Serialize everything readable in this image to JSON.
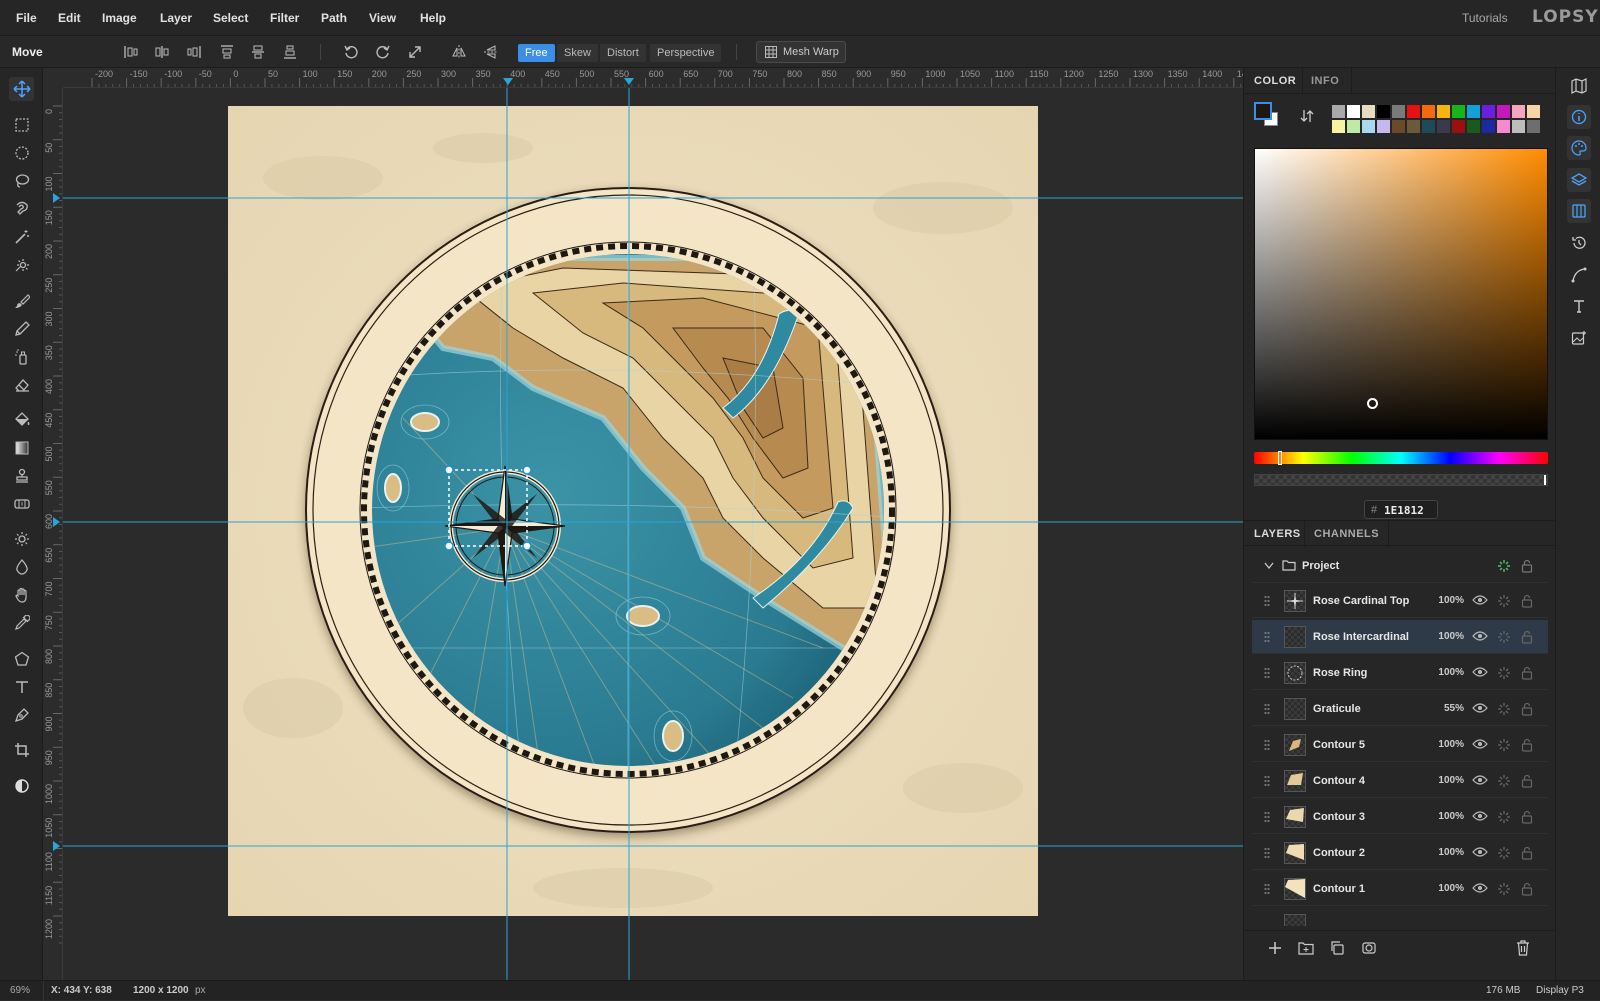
{
  "menu": {
    "items": [
      "File",
      "Edit",
      "Image",
      "Layer",
      "Select",
      "Filter",
      "Path",
      "View",
      "Help"
    ],
    "tutorials": "Tutorials",
    "logo": "LOPSY"
  },
  "options": {
    "tool_name": "Move",
    "modes": [
      "Free",
      "Skew",
      "Distort",
      "Perspective"
    ],
    "active_mode": "Free",
    "mesh_warp": "Mesh Warp"
  },
  "ruler": {
    "top": [
      "-200",
      "-150",
      "-100",
      "-50",
      "0",
      "50",
      "100",
      "150",
      "200",
      "250",
      "300",
      "350",
      "400",
      "450",
      "500",
      "550",
      "600",
      "650",
      "700",
      "750",
      "800",
      "850",
      "900",
      "950",
      "1000",
      "1050",
      "1100",
      "1150",
      "1200",
      "1250",
      "1300",
      "1350",
      "1400",
      "14"
    ],
    "left": [
      "0",
      "50",
      "100",
      "150",
      "200",
      "250",
      "300",
      "350",
      "400",
      "450",
      "500",
      "550",
      "600",
      "650",
      "700",
      "750",
      "800",
      "850",
      "900",
      "950",
      "1000",
      "1050",
      "1100",
      "1150",
      "1200"
    ]
  },
  "color_panel": {
    "tabs": [
      "COLOR",
      "INFO"
    ],
    "active_tab": "COLOR",
    "hex_prefix": "#",
    "hex": "1E1812",
    "foreground": "#1E1812",
    "background": "#ffffff",
    "swatches": [
      "#a7a9ab",
      "#ffffff",
      "#e8dcc0",
      "#000000",
      "#7a7a7a",
      "#e81010",
      "#f46a0f",
      "#f6b40e",
      "#18b51a",
      "#139fd8",
      "#6a1ee0",
      "#c21ab8",
      "#f4a6bf",
      "#f6d6a6",
      "#f7f3a0",
      "#bfe9a6",
      "#a7d8ee",
      "#c8b7ef",
      "#6b4a2a",
      "#6a5a3a",
      "#1e4a5a",
      "#3a3a4a",
      "#9a1010",
      "#1a5a1a",
      "#1a2aa0",
      "#f58ad0",
      "#bdbdbd",
      "#6e6e6e"
    ]
  },
  "layers_panel": {
    "tabs": [
      "LAYERS",
      "CHANNELS"
    ],
    "active_tab": "LAYERS",
    "group": "Project",
    "layers": [
      {
        "name": "Rose Cardinal Top",
        "opacity": "100%"
      },
      {
        "name": "Rose Intercardinal",
        "opacity": "100%"
      },
      {
        "name": "Rose Ring",
        "opacity": "100%"
      },
      {
        "name": "Graticule",
        "opacity": "55%"
      },
      {
        "name": "Contour 5",
        "opacity": "100%"
      },
      {
        "name": "Contour 4",
        "opacity": "100%"
      },
      {
        "name": "Contour 3",
        "opacity": "100%"
      },
      {
        "name": "Contour 2",
        "opacity": "100%"
      },
      {
        "name": "Contour 1",
        "opacity": "100%"
      }
    ],
    "selected_layer": "Rose Intercardinal"
  },
  "status": {
    "zoom": "69%",
    "coords": "X: 434 Y: 638",
    "size": "1200 x 1200",
    "unit": "px",
    "memory": "176 MB",
    "profile": "Display P3"
  }
}
